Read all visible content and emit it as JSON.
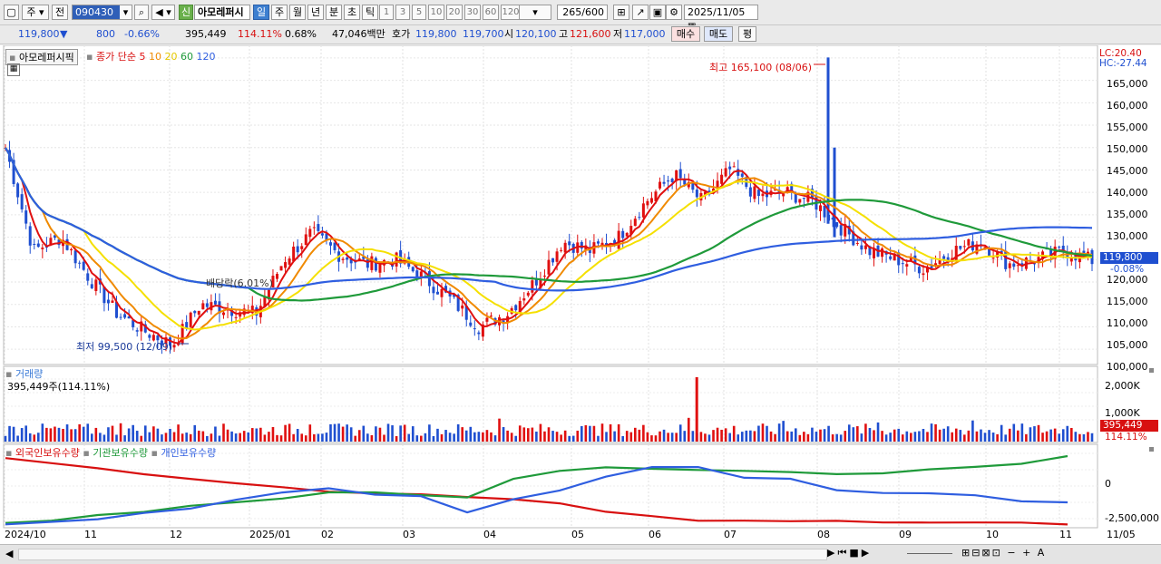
{
  "toolbar": {
    "market": "주",
    "scope": "전",
    "code": "090430",
    "badge": "신",
    "stock_name": "아모레퍼시",
    "periods": [
      "일",
      "주",
      "월",
      "년",
      "분",
      "초",
      "틱"
    ],
    "active_period": "일",
    "minutes": [
      "1",
      "3",
      "5",
      "10",
      "20",
      "30",
      "60",
      "120"
    ],
    "count": "265",
    "count_max": "/600",
    "date": "2025/11/05"
  },
  "quote": {
    "price": "119,800",
    "change_arrow": "▼",
    "change": "800",
    "change_pct": "-0.66%",
    "volume": "395,449",
    "vol_ratio": "114.11%",
    "turnover_pct": "0.68%",
    "amount": "47,046백만",
    "hoga_label": "호가",
    "ask": "119,800",
    "bid": "119,700",
    "open_label": "시",
    "open": "120,100",
    "high_label": "고",
    "high": "121,600",
    "low_label": "저",
    "low": "117,000",
    "buy_label": "매수",
    "sell_label": "매도",
    "eval_label": "평"
  },
  "price_pane": {
    "stock_label": "아모레퍼시픽",
    "ma_title": "종가 단순",
    "ma_periods": [
      "5",
      "10",
      "20",
      "60",
      "120"
    ],
    "ma_colors": [
      "#e01010",
      "#f08a00",
      "#f5e000",
      "#1f9a3a",
      "#2f5ee0"
    ],
    "lc": "LC:20.40",
    "hc": "HC:-27.44",
    "max_note": "최고 165,100 (08/06)",
    "min_note": "최저 99,500 (12/09)",
    "dividend": "배당락(6.01%)",
    "last_price": "119,800",
    "last_pct": "-0.08%",
    "ticks": [
      "165,000",
      "160,000",
      "155,000",
      "150,000",
      "145,000",
      "140,000",
      "135,000",
      "130,000",
      "125,000",
      "120,000",
      "115,000",
      "110,000",
      "105,000",
      "100,000"
    ]
  },
  "volume_pane": {
    "title": "거래량",
    "info": "395,449주(114.11%)",
    "ticks": [
      "2,000K",
      "1,000K"
    ],
    "last_val": "395,449",
    "last_pct": "114.11%"
  },
  "holdings_pane": {
    "titles": [
      "외국인보유수량",
      "기관보유수량",
      "개인보유수량"
    ],
    "colors": [
      "#d81010",
      "#1f9a3a",
      "#2f5ee0"
    ],
    "ticks": [
      "0",
      "-2,500,000"
    ]
  },
  "x_axis": [
    "2024/10",
    "11",
    "12",
    "2025/01",
    "02",
    "03",
    "04",
    "05",
    "06",
    "07",
    "08",
    "09",
    "10",
    "11",
    "11/05"
  ],
  "chart_data": {
    "type": "candlestick",
    "dates_note": "Daily, 2024/10 to 2025/11/05",
    "ylim": [
      97000,
      167000
    ],
    "close_points": [
      {
        "x": "2024/10",
        "y": 145000
      },
      {
        "x": "2024/10",
        "y": 122000
      },
      {
        "x": "11",
        "y": 125000
      },
      {
        "x": "11",
        "y": 116000
      },
      {
        "x": "11",
        "y": 108000
      },
      {
        "x": "12",
        "y": 104000
      },
      {
        "x": "12",
        "y": 101000
      },
      {
        "x": "12",
        "y": 110000
      },
      {
        "x": "2025/01",
        "y": 109000
      },
      {
        "x": "2025/01",
        "y": 108000
      },
      {
        "x": "2025/01",
        "y": 120000
      },
      {
        "x": "02",
        "y": 126000
      },
      {
        "x": "02",
        "y": 121000
      },
      {
        "x": "02",
        "y": 119000
      },
      {
        "x": "03",
        "y": 120000
      },
      {
        "x": "03",
        "y": 116000
      },
      {
        "x": "03",
        "y": 111000
      },
      {
        "x": "04",
        "y": 105000
      },
      {
        "x": "04",
        "y": 108000
      },
      {
        "x": "04",
        "y": 115000
      },
      {
        "x": "05",
        "y": 124000
      },
      {
        "x": "05",
        "y": 122000
      },
      {
        "x": "05",
        "y": 125000
      },
      {
        "x": "06",
        "y": 133000
      },
      {
        "x": "06",
        "y": 139000
      },
      {
        "x": "06",
        "y": 133000
      },
      {
        "x": "07",
        "y": 140000
      },
      {
        "x": "07",
        "y": 134000
      },
      {
        "x": "07",
        "y": 135000
      },
      {
        "x": "08",
        "y": 133000
      },
      {
        "x": "08",
        "y": 127000
      },
      {
        "x": "08",
        "y": 122000
      },
      {
        "x": "09",
        "y": 120000
      },
      {
        "x": "09",
        "y": 118000
      },
      {
        "x": "09",
        "y": 122000
      },
      {
        "x": "10",
        "y": 124000
      },
      {
        "x": "10",
        "y": 119000
      },
      {
        "x": "10",
        "y": 120000
      },
      {
        "x": "11",
        "y": 122000
      },
      {
        "x": "11/05",
        "y": 119800
      }
    ],
    "max": {
      "date": "08/06",
      "value": 165100
    },
    "min": {
      "date": "12/09",
      "value": 99500
    }
  }
}
